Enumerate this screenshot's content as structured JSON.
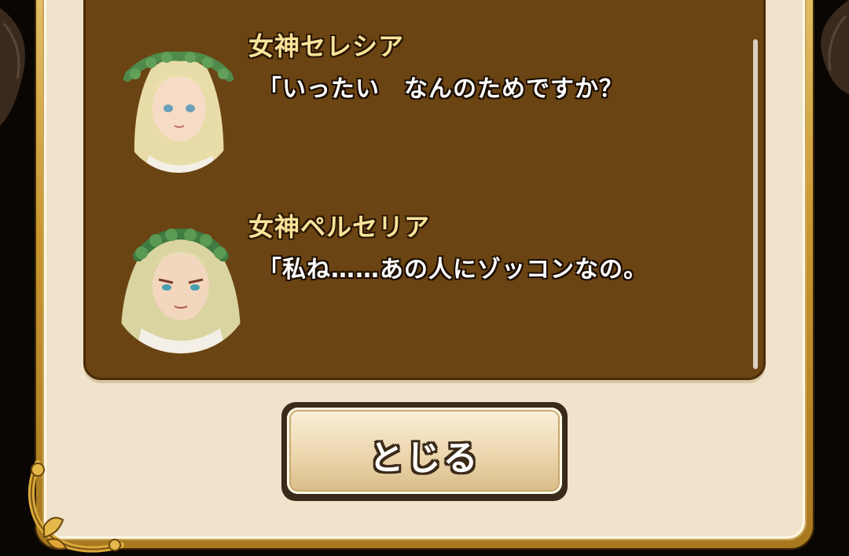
{
  "dialog_log": {
    "entries": [
      {
        "speaker": "女神セレシア",
        "text": "「いったい　なんのためですか？"
      },
      {
        "speaker": "女神ペルセリア",
        "text": "「私ね……あの人にゾッコンなの。"
      }
    ]
  },
  "close_button": {
    "label": "とじる"
  },
  "colors": {
    "log_background": "#6b4413",
    "panel_background": "#efe3cb",
    "frame_gold": "#c9972f",
    "speaker_name": "#f7e39a"
  },
  "icons": {
    "portrait_1": "goddess-celesia-portrait",
    "portrait_2": "goddess-perselia-portrait",
    "ornament": "gold-corner-ornament"
  }
}
